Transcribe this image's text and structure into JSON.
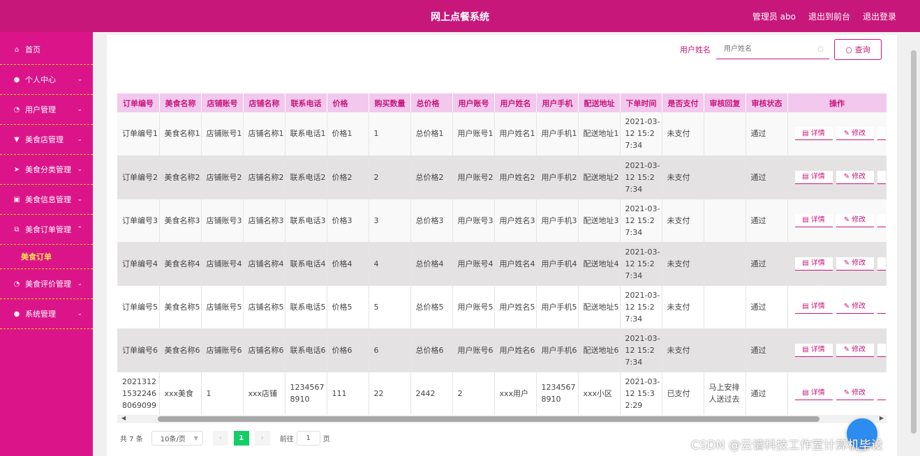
{
  "header": {
    "title": "网上点餐系统",
    "admin": "管理员 abo",
    "front_link": "退出到前台",
    "logout": "退出登录"
  },
  "sidebar": {
    "items": [
      {
        "label": "首页",
        "icon": "home-icon",
        "chevron": false
      },
      {
        "label": "个人中心",
        "icon": "user-icon",
        "chevron": true
      },
      {
        "label": "用户管理",
        "icon": "compass-icon",
        "chevron": true
      },
      {
        "label": "美食店管理",
        "icon": "cup-icon",
        "chevron": true
      },
      {
        "label": "美食分类管理",
        "icon": "send-icon",
        "chevron": true
      },
      {
        "label": "美食信息管理",
        "icon": "clipboard-icon",
        "chevron": true
      },
      {
        "label": "美食订单管理",
        "icon": "copy-icon",
        "chevron": "up"
      },
      {
        "label": "美食订单",
        "sub": true
      },
      {
        "label": "美食评价管理",
        "icon": "compass-icon",
        "chevron": true
      },
      {
        "label": "系统管理",
        "icon": "user-icon",
        "chevron": true
      }
    ]
  },
  "search": {
    "label": "用户姓名",
    "placeholder": "用户姓名",
    "button": "查询"
  },
  "table": {
    "headers": [
      "订单编号",
      "美食名称",
      "店铺账号",
      "店铺名称",
      "联系电话",
      "价格",
      "购买数量",
      "总价格",
      "用户账号",
      "用户姓名",
      "用户手机",
      "配送地址",
      "下单时间",
      "是否支付",
      "审核回复",
      "审核状态",
      "操作"
    ],
    "detail_label": "详情",
    "edit_label": "修改",
    "rows": [
      [
        "订单编号1",
        "美食名称1",
        "店铺账号1",
        "店铺名称1",
        "联系电话1",
        "价格1",
        "1",
        "总价格1",
        "用户账号1",
        "用户姓名1",
        "用户手机1",
        "配送地址1",
        "2021-03-12 15:27:34",
        "未支付",
        "",
        "通过"
      ],
      [
        "订单编号2",
        "美食名称2",
        "店铺账号2",
        "店铺名称2",
        "联系电话2",
        "价格2",
        "2",
        "总价格2",
        "用户账号2",
        "用户姓名2",
        "用户手机2",
        "配送地址2",
        "2021-03-12 15:27:34",
        "未支付",
        "",
        "通过"
      ],
      [
        "订单编号3",
        "美食名称3",
        "店铺账号3",
        "店铺名称3",
        "联系电话3",
        "价格3",
        "3",
        "总价格3",
        "用户账号3",
        "用户姓名3",
        "用户手机3",
        "配送地址3",
        "2021-03-12 15:27:34",
        "未支付",
        "",
        "通过"
      ],
      [
        "订单编号4",
        "美食名称4",
        "店铺账号4",
        "店铺名称4",
        "联系电话4",
        "价格4",
        "4",
        "总价格4",
        "用户账号4",
        "用户姓名4",
        "用户手机4",
        "配送地址4",
        "2021-03-12 15:27:34",
        "未支付",
        "",
        "通过"
      ],
      [
        "订单编号5",
        "美食名称5",
        "店铺账号5",
        "店铺名称5",
        "联系电话5",
        "价格5",
        "5",
        "总价格5",
        "用户账号5",
        "用户姓名5",
        "用户手机5",
        "配送地址5",
        "2021-03-12 15:27:34",
        "未支付",
        "",
        "通过"
      ],
      [
        "订单编号6",
        "美食名称6",
        "店铺账号6",
        "店铺名称6",
        "联系电话6",
        "价格6",
        "6",
        "总价格6",
        "用户账号6",
        "用户姓名6",
        "用户手机6",
        "配送地址6",
        "2021-03-12 15:27:34",
        "未支付",
        "",
        "通过"
      ],
      [
        "202131215322468069099",
        "xxx美食",
        "1",
        "xxx店铺",
        "12345678910",
        "111",
        "22",
        "2442",
        "2",
        "xxx用户",
        "12345678910",
        "xxx小区",
        "2021-03-12 15:32:29",
        "已支付",
        "马上安排人送过去",
        "通过"
      ]
    ]
  },
  "pager": {
    "total": "共 7 条",
    "page_size": "10条/页",
    "current": "1",
    "goto_prefix": "前往",
    "goto_value": "1",
    "goto_suffix": "页"
  },
  "watermark": "CSDN @云谱科技工作室计算机毕设",
  "colors": {
    "brand": "#c8177a",
    "sidebar": "#dc148a",
    "header_row": "#f2c8ee",
    "active_sub": "#ffe14d",
    "page_active": "#13ce66"
  }
}
